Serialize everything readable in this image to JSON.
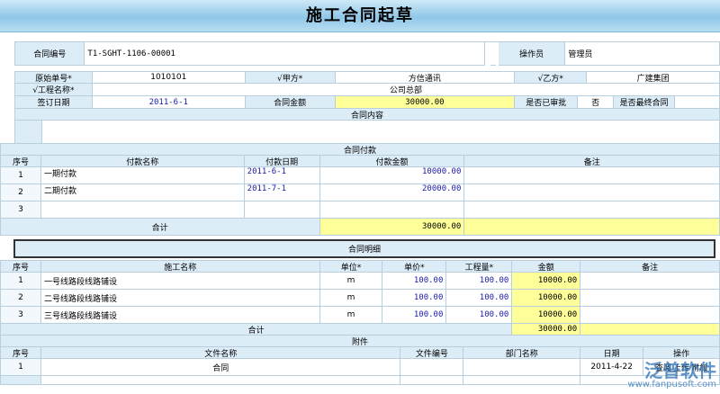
{
  "title": "施工合同起草",
  "header": {
    "contract_no_label": "合同编号",
    "contract_no": "T1-SGHT-1106-00001",
    "operator_label": "操作员",
    "operator": "管理员"
  },
  "info": {
    "orig_no_label": "原始单号*",
    "orig_no": "1010101",
    "party_a_label": "√甲方*",
    "party_a": "方信通讯",
    "party_b_label": "√乙方*",
    "party_b": "广建集团",
    "project_label": "√工程名称*",
    "project": "公司总部",
    "sign_date_label": "签订日期",
    "sign_date": "2011-6-1",
    "amount_label": "合同金额",
    "amount": "30000.00",
    "approved_label": "是否已审批",
    "approved": "否",
    "final_label": "是否最终合同",
    "final": ""
  },
  "content_section": "合同内容",
  "payment": {
    "section": "合同付款",
    "columns": [
      "序号",
      "付款名称",
      "付款日期",
      "付款金额",
      "备注"
    ],
    "rows": [
      {
        "no": "1",
        "name": "一期付款",
        "date": "2011-6-1",
        "amount": "10000.00",
        "note": ""
      },
      {
        "no": "2",
        "name": "二期付款",
        "date": "2011-7-1",
        "amount": "20000.00",
        "note": ""
      },
      {
        "no": "3",
        "name": "",
        "date": "",
        "amount": "",
        "note": ""
      }
    ],
    "total_label": "合计",
    "total": "30000.00"
  },
  "detail": {
    "section": "合同明细",
    "columns": [
      "序号",
      "施工名称",
      "单位*",
      "单价*",
      "工程量*",
      "金额",
      "备注"
    ],
    "rows": [
      {
        "no": "1",
        "name": "一号线路段线路铺设",
        "unit": "m",
        "price": "100.00",
        "qty": "100.00",
        "amount": "10000.00",
        "note": ""
      },
      {
        "no": "2",
        "name": "二号线路段线路铺设",
        "unit": "m",
        "price": "100.00",
        "qty": "100.00",
        "amount": "10000.00",
        "note": ""
      },
      {
        "no": "3",
        "name": "三号线路段线路铺设",
        "unit": "m",
        "price": "100.00",
        "qty": "100.00",
        "amount": "10000.00",
        "note": ""
      }
    ],
    "total_label": "合计",
    "total": "30000.00"
  },
  "attachment": {
    "section": "附件",
    "columns": [
      "序号",
      "文件名称",
      "文件编号",
      "部门名称",
      "日期",
      "操作"
    ],
    "rows": [
      {
        "no": "1",
        "name": "合同",
        "code": "",
        "dept": "",
        "date": "2011-4-22",
        "ops": [
          "查阅",
          "上传",
          "附加"
        ]
      }
    ]
  },
  "watermark": {
    "text": "泛普软件",
    "url": "www.fanpusoft.com"
  }
}
